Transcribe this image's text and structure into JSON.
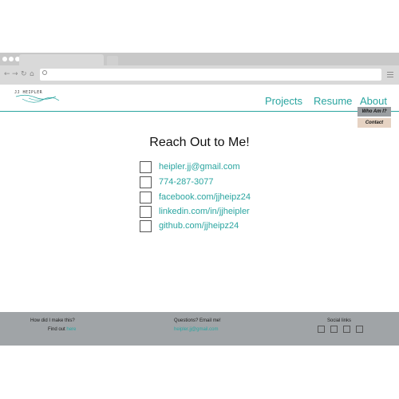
{
  "colors": {
    "accent": "#2aa5a0",
    "footer_bg": "#a0a4a7",
    "dropdown_who_bg": "#9a9ea1",
    "dropdown_contact_bg": "#e6d3c3",
    "browser_chrome": "#d9d9d9"
  },
  "browser": {
    "url": ""
  },
  "header": {
    "logo_text": "JJ HEIPLER",
    "nav": {
      "projects": "Projects",
      "resume": "Resume",
      "about": "About"
    },
    "about_dropdown": {
      "who_am_i": "Who Am I?",
      "contact": "Contact"
    }
  },
  "main": {
    "heading": "Reach Out to Me!",
    "contacts": [
      {
        "text": "heipler.jj@gmail.com",
        "icon": "email-icon"
      },
      {
        "text": "774-287-3077",
        "icon": "phone-icon"
      },
      {
        "text": "facebook.com/jjheipz24",
        "icon": "facebook-icon"
      },
      {
        "text": "linkedin.com/in/jjheipler",
        "icon": "linkedin-icon"
      },
      {
        "text": "github.com/jjheipz24",
        "icon": "github-icon"
      }
    ]
  },
  "footer": {
    "made_question": "How did I make this?",
    "find_out": "Find out ",
    "here_link": "here",
    "questions": "Questions? Email me!",
    "email": "heipler.jj@gmail.com",
    "social_title": "Social links",
    "social_icons": [
      "facebook-icon",
      "linkedin-icon",
      "github-icon",
      "email-icon"
    ]
  }
}
